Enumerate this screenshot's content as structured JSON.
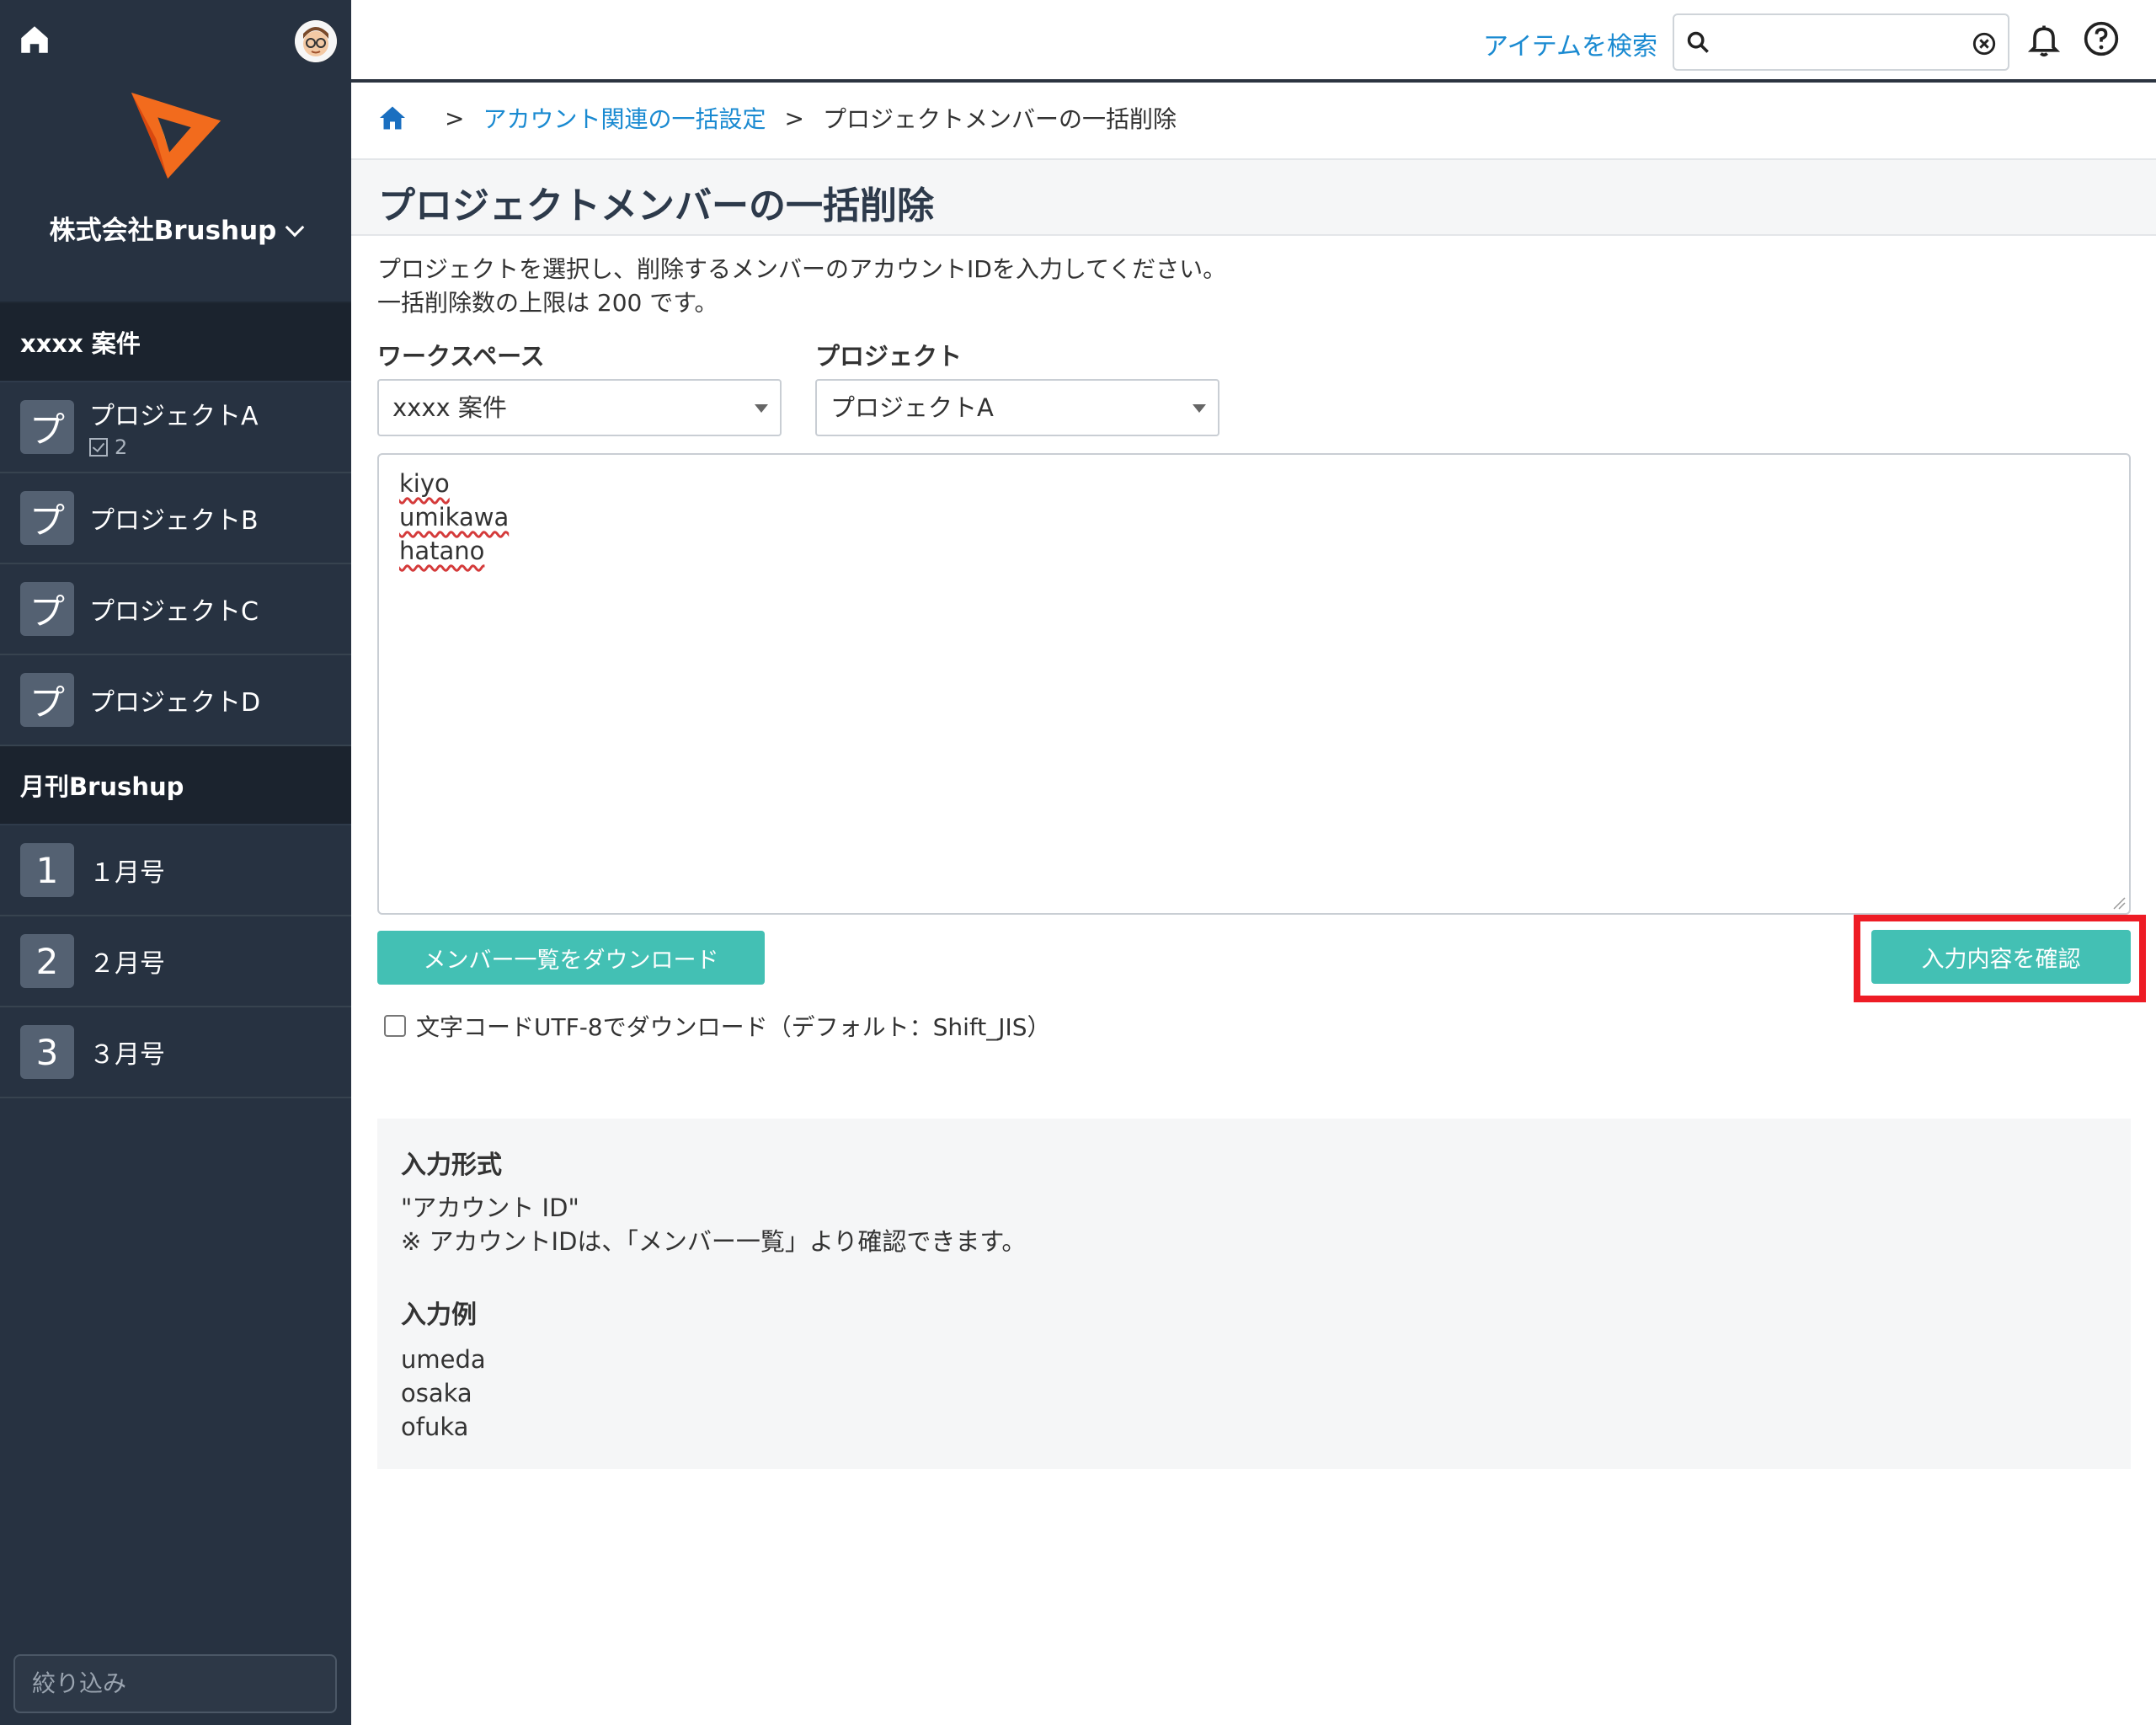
{
  "sidebar": {
    "company": "株式会社Brushup",
    "groups": [
      {
        "title": "xxxx 案件",
        "items": [
          {
            "badge": "プ",
            "label": "プロジェクトA",
            "count": "2"
          },
          {
            "badge": "プ",
            "label": "プロジェクトB"
          },
          {
            "badge": "プ",
            "label": "プロジェクトC"
          },
          {
            "badge": "プ",
            "label": "プロジェクトD"
          }
        ]
      },
      {
        "title": "月刊Brushup",
        "items": [
          {
            "badge": "1",
            "label": "１月号"
          },
          {
            "badge": "2",
            "label": "２月号"
          },
          {
            "badge": "3",
            "label": "３月号"
          }
        ]
      }
    ],
    "filter_placeholder": "絞り込み"
  },
  "topbar": {
    "search_link": "アイテムを検索",
    "search_value": ""
  },
  "breadcrumb": {
    "sep": ">",
    "link": "アカウント関連の一括設定",
    "current": "プロジェクトメンバーの一括削除"
  },
  "page": {
    "title": "プロジェクトメンバーの一括削除",
    "desc_line1": "プロジェクトを選択し、削除するメンバーのアカウントIDを入力してください。",
    "desc_line2": "一括削除数の上限は 200 です。",
    "workspace_label": "ワークスペース",
    "workspace_value": "xxxx 案件",
    "project_label": "プロジェクト",
    "project_value": "プロジェクトA",
    "textarea_lines": [
      "kiyo",
      "umikawa",
      "hatano"
    ],
    "download_button": "メンバー一覧をダウンロード",
    "confirm_button": "入力内容を確認",
    "utf8_checkbox_label": "文字コードUTF-8でダウンロード（デフォルト：Shift_JIS）",
    "utf8_checked": false
  },
  "help": {
    "format_title": "入力形式",
    "format_line1": "\"アカウント ID\"",
    "format_line2": "※ アカウントIDは、「メンバー一覧」より確認できます。",
    "example_title": "入力例",
    "examples": [
      "umeda",
      "osaka",
      "ofuka"
    ]
  },
  "colors": {
    "sidebar_bg": "#273241",
    "accent_teal": "#43c0b4",
    "link_blue": "#1a8ad1",
    "highlight_red": "#ee1c25",
    "logo_orange": "#f26b1d"
  }
}
